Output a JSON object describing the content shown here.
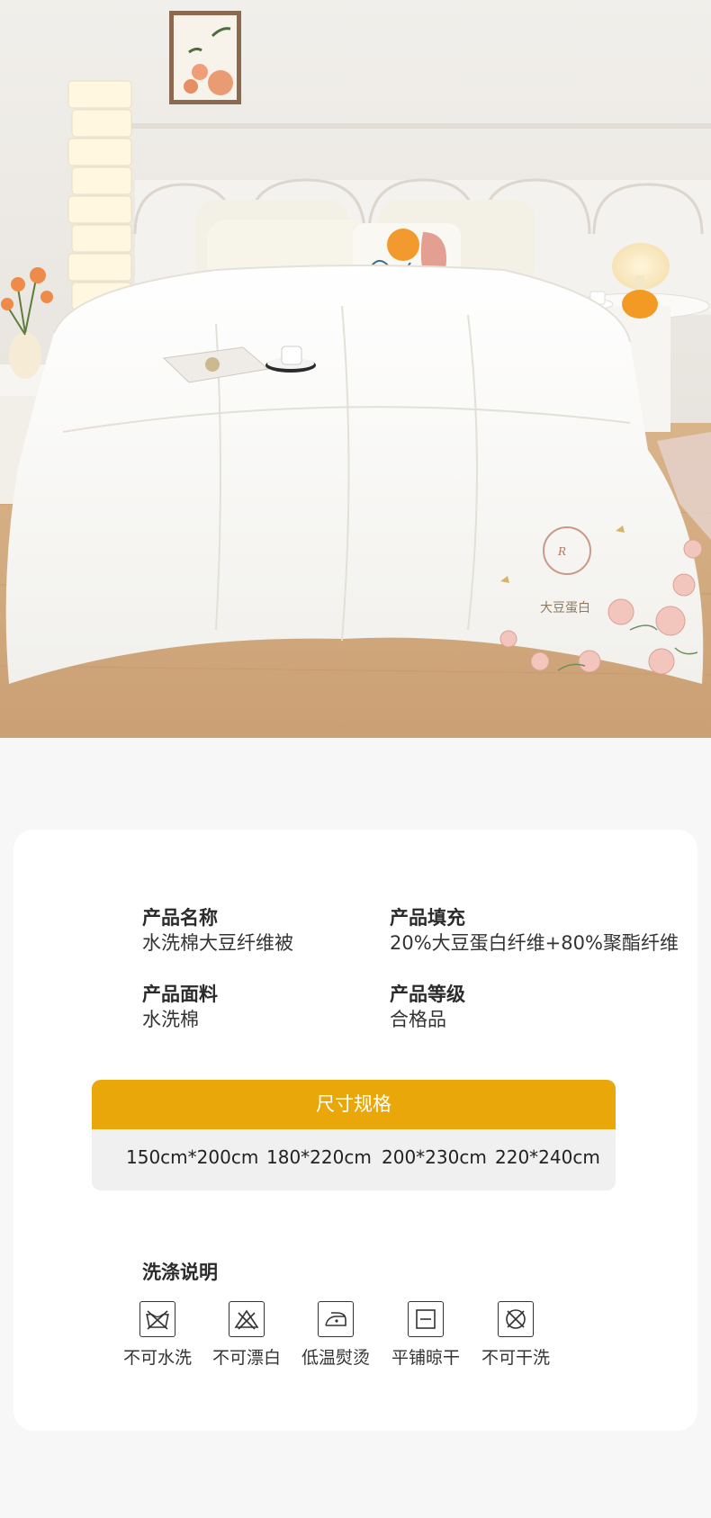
{
  "hero": {
    "alt": "白色水洗棉大豆纤维被铺在床上",
    "embroidery_text": "大豆蛋白"
  },
  "specs": [
    {
      "label": "产品名称",
      "value": "水洗棉大豆纤维被"
    },
    {
      "label": "产品填充",
      "value": "20%大豆蛋白纤维+80%聚酯纤维"
    },
    {
      "label": "产品面料",
      "value": "水洗棉"
    },
    {
      "label": "产品等级",
      "value": "合格品"
    }
  ],
  "sizes": {
    "title": "尺寸规格",
    "items": [
      "150cm*200cm",
      "180*220cm",
      "200*230cm",
      "220*240cm"
    ],
    "accent": "#e9a70a"
  },
  "wash": {
    "title": "洗涤说明",
    "items": [
      {
        "icon": "no-wash-icon",
        "label": "不可水洗"
      },
      {
        "icon": "no-bleach-icon",
        "label": "不可漂白"
      },
      {
        "icon": "low-iron-icon",
        "label": "低温熨烫"
      },
      {
        "icon": "flat-dry-icon",
        "label": "平铺晾干"
      },
      {
        "icon": "no-dry-clean-icon",
        "label": "不可干洗"
      }
    ]
  }
}
